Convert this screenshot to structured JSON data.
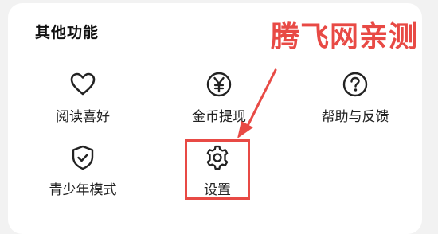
{
  "section": {
    "title": "其他功能"
  },
  "watermark": "腾飞网亲测",
  "items": [
    {
      "label": "阅读喜好",
      "icon": "heart-icon"
    },
    {
      "label": "金币提现",
      "icon": "yen-coin-icon"
    },
    {
      "label": "帮助与反馈",
      "icon": "help-circle-icon"
    },
    {
      "label": "青少年模式",
      "icon": "shield-check-icon"
    },
    {
      "label": "设置",
      "icon": "gear-icon"
    }
  ],
  "colors": {
    "annotation": "#e84a45",
    "icon_stroke": "#222222",
    "card_background": "#ffffff",
    "page_background": "#f2f2f2"
  }
}
